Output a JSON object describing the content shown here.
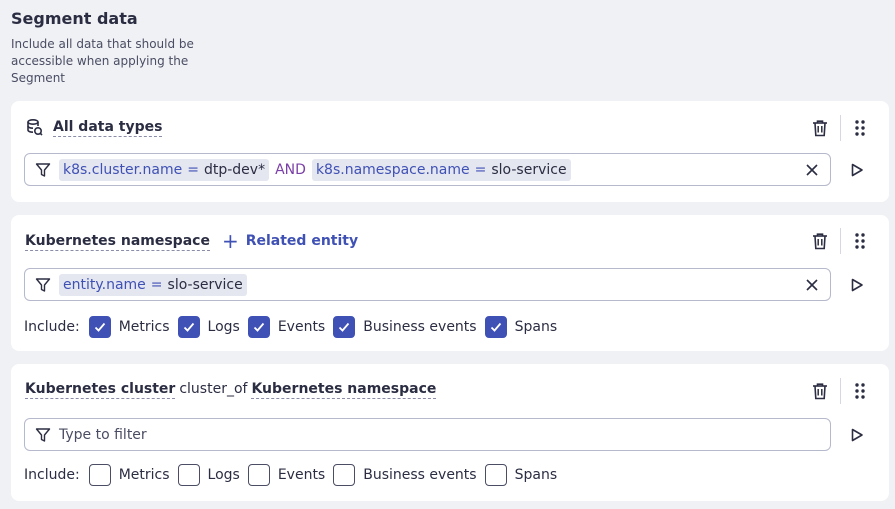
{
  "header": {
    "title": "Segment data",
    "description": "Include all data that should be accessible when applying the Segment"
  },
  "cards": [
    {
      "type_label": "All data types",
      "filter_tokens": [
        {
          "key": "k8s.cluster.name",
          "op": "=",
          "value": "dtp-dev*"
        },
        {
          "key": "k8s.namespace.name",
          "op": "=",
          "value": "slo-service"
        }
      ],
      "connector": "AND"
    },
    {
      "type_label": "Kubernetes namespace",
      "related_label": "Related entity",
      "filter_tokens": [
        {
          "key": "entity.name",
          "op": "=",
          "value": "slo-service"
        }
      ],
      "include_label": "Include:",
      "includes": [
        {
          "label": "Metrics",
          "checked": true
        },
        {
          "label": "Logs",
          "checked": true
        },
        {
          "label": "Events",
          "checked": true
        },
        {
          "label": "Business events",
          "checked": true
        },
        {
          "label": "Spans",
          "checked": true
        }
      ]
    },
    {
      "type_label": "Kubernetes cluster",
      "relation": "cluster_of",
      "target_label": "Kubernetes namespace",
      "filter_placeholder": "Type to filter",
      "include_label": "Include:",
      "includes": [
        {
          "label": "Metrics",
          "checked": false
        },
        {
          "label": "Logs",
          "checked": false
        },
        {
          "label": "Events",
          "checked": false
        },
        {
          "label": "Business events",
          "checked": false
        },
        {
          "label": "Spans",
          "checked": false
        }
      ]
    }
  ],
  "colors": {
    "accent": "#3f51b5",
    "background": "#f0f1f5",
    "card": "#ffffff",
    "text": "#2b2d42",
    "and_operator": "#7b3fa8"
  },
  "icons": {
    "card_type": "database-icon",
    "delete": "trash-icon",
    "drag": "drag-handle-icon",
    "filter": "funnel-icon",
    "clear": "close-icon",
    "run": "play-icon",
    "check": "checkmark-icon",
    "add": "plus-icon"
  }
}
